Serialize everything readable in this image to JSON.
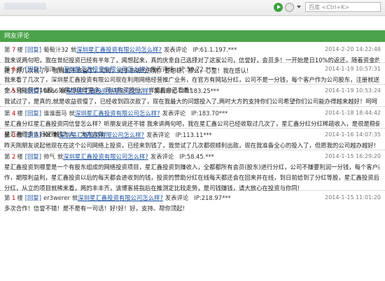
{
  "toolbar": {
    "search_placeholder": "百度 <Ctrl+K>"
  },
  "section_title": "网友评论",
  "ui": {
    "floor_word": "楼",
    "tag": "[回复]",
    "asks": "就",
    "action": "发表评论",
    "ip_label": "IP:"
  },
  "comments": [
    {
      "floor": "7",
      "user": "葡萄汁32",
      "topic": "深圳星汇鑫投资有限公司怎么样?",
      "ip": "61.1.197.***",
      "time": "2014-2-20 14:22:48",
      "lines": [
        "我来说两句吧，我在世纪投资已经有半年了，闻想起来，真的庆幸自己选择对了这家公司，信誉好，会员多！一开始是日10%的返还，随着资金的增多，返还率会更高，我已经",
        "提了好几次钱了， 我目前不准备了，可时，对手市场的预期，要想稳，那么，心里！我在感认!"
      ]
    },
    {
      "floor": "6",
      "user": "海洋",
      "topic": "深圳星汇鑫投资有限公司怎么样?",
      "ip": "59.72.***",
      "time": "2014-1-19 10:57:31",
      "lines": [
        "我来看了几次了，深圳星汇鑫投资有限公司现在利用网络经营推广业务，在官方有网站分红，公司不是一分钱，每个客户作为公司股东，注册就送30元，可以投资30元项目，获得公司10股分红，每",
        "个人只能获得10股，如果想获得更多，可以购买股份！ 详情后自己看看!"
      ]
    },
    {
      "floor": "5",
      "user": "6666",
      "topic": "深圳星汇鑫投资有限公司怎么样?",
      "ip": "183.25***",
      "time": "2014-1-19 10:53:24",
      "lines": [
        "我试过了，是真的,就是收益很慢了，已经收到四次款了，现在我最大的问题投入了,两时大方的支持你们公司希望你们公司能办得越来越好！呵呵"
      ]
    },
    {
      "floor": "4",
      "user": "谁谁面马",
      "topic": "深圳星汇鑫投资有限公司怎么样?",
      "ip": "183.70***",
      "time": "2014-1-18 18:44:42",
      "lines": [
        "星汇鑫分红星汇鑫投资同信誉怎么样？听朋友说还不错 我来讲两句吧，我在星汇鑫公司已经收取过几次了，星汇鑫分红分红稀疏收入，是很是稳健的投资方式(会员身手上，此政的信",
        "星汇鑫很多人好好赚钱为人。大方去做!"
      ]
    },
    {
      "floor": "3",
      "user": "KK",
      "topic": "深圳星汇鑫投资有限公司怎么样?",
      "ip": "113.11***",
      "time": "2014-1-16 14:07:35",
      "lines": [
        "昨天刚朋友说起他现在在这个公司网络上投资，已经来到钱了，我觉试了几次都很顺利出款，现在我准备全心的投入了，但愿我的公司越办越好!"
      ]
    },
    {
      "floor": "2",
      "user": "帅气",
      "topic": "深圳星汇鑫投资有限公司怎么样?",
      "ip": "58.45.***",
      "time": "2014-1-15 16:29:20",
      "lines": [
        "星汇鑫投资到哪里是一个有股东组成的网络投资项目，星汇鑫投资到赚收入，全都都所有会员(股东)进行分红，公司不赚要利润一分钱，每个客户都是以公司股东的身份获得收",
        "作，期限利益利，星汇鑫投资以后的每天都会进收到的钱，投资的赞助分红在线每天都还会在回来并在线，到日前给到了分红等股，星汇鑫投资后的分红日率的为利益的投资人",
        "分红，从立的项目就稀来看，两的丰丰齐，该博客将指后在推测定比较走势，是司钱赚钱，请大放心在投资与你同!"
      ]
    },
    {
      "floor": "1",
      "user": "er3werer",
      "topic": "深圳星汇鑫投资有限公司怎么样?",
      "ip": "218.97***",
      "time": "2014-1-15 11:01:20",
      "lines": [
        "多次合作！信誉不错！是不是有一司话！好!好！好，支持。帮你顶起!"
      ]
    }
  ]
}
